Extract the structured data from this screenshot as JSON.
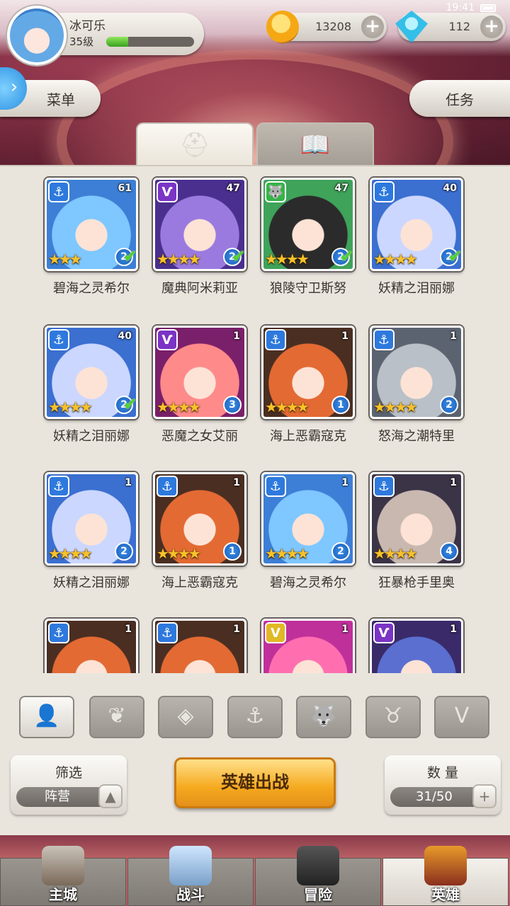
{
  "status": {
    "time": "19:41"
  },
  "player": {
    "name": "冰可乐",
    "level": "35级",
    "xp_fraction": 0.25
  },
  "currency": {
    "gold": "13208",
    "gems": "112"
  },
  "menu_label": "菜单",
  "task_label": "任务",
  "tabs": [
    "heroes-helmet-icon",
    "book-icon"
  ],
  "heroes": [
    {
      "name": "碧海之灵希尔",
      "level": "61",
      "stars": 3,
      "badge": "2",
      "check": true,
      "faction": "anchor"
    },
    {
      "name": "魔典阿米莉亚",
      "level": "47",
      "stars": 4,
      "badge": "2",
      "check": true,
      "faction": "horns"
    },
    {
      "name": "狼陵守卫斯努",
      "level": "47",
      "stars": 4,
      "badge": "2",
      "check": true,
      "faction": "wolf"
    },
    {
      "name": "妖精之泪丽娜",
      "level": "40",
      "stars": 4,
      "badge": "2",
      "check": true,
      "faction": "anchor"
    },
    {
      "name": "妖精之泪丽娜",
      "level": "40",
      "stars": 4,
      "badge": "2",
      "check": true,
      "faction": "anchor"
    },
    {
      "name": "恶魔之女艾丽",
      "level": "1",
      "stars": 4,
      "badge": "3",
      "check": false,
      "faction": "horns"
    },
    {
      "name": "海上恶霸寇克",
      "level": "1",
      "stars": 4,
      "badge": "1",
      "check": false,
      "faction": "anchor"
    },
    {
      "name": "怒海之潮特里",
      "level": "1",
      "stars": 4,
      "badge": "2",
      "check": false,
      "faction": "anchor"
    },
    {
      "name": "妖精之泪丽娜",
      "level": "1",
      "stars": 4,
      "badge": "2",
      "check": false,
      "faction": "anchor"
    },
    {
      "name": "海上恶霸寇克",
      "level": "1",
      "stars": 4,
      "badge": "1",
      "check": false,
      "faction": "anchor"
    },
    {
      "name": "碧海之灵希尔",
      "level": "1",
      "stars": 4,
      "badge": "2",
      "check": false,
      "faction": "anchor"
    },
    {
      "name": "狂暴枪手里奥",
      "level": "1",
      "stars": 4,
      "badge": "4",
      "check": false,
      "faction": "anchor"
    },
    {
      "name": "",
      "level": "1",
      "stars": 0,
      "badge": "",
      "check": false,
      "faction": "anchor"
    },
    {
      "name": "",
      "level": "1",
      "stars": 0,
      "badge": "",
      "check": false,
      "faction": "anchor"
    },
    {
      "name": "",
      "level": "1",
      "stars": 0,
      "badge": "",
      "check": false,
      "faction": "gold"
    },
    {
      "name": "",
      "level": "1",
      "stars": 0,
      "badge": "",
      "check": false,
      "faction": "horns"
    }
  ],
  "filters": [
    "person-icon",
    "leaf-icon",
    "diamond-icon",
    "anchor-icon",
    "wolf-icon",
    "horns-icon",
    "v-icon"
  ],
  "filter_box": {
    "title": "筛选",
    "value": "阵营"
  },
  "deploy_label": "英雄出战",
  "count_box": {
    "title": "数 量",
    "value": "31/50"
  },
  "nav": [
    {
      "label": "主城",
      "icon": "castle-icon"
    },
    {
      "label": "战斗",
      "icon": "swords-icon"
    },
    {
      "label": "冒险",
      "icon": "treasure-icon"
    },
    {
      "label": "英雄",
      "icon": "helmet-icon",
      "active": true
    }
  ],
  "colors": {
    "water": "#2e79dd",
    "purple": "#7b34c5",
    "green": "#34b546",
    "gold": "#e1b825",
    "deploy": "#f5a91e"
  }
}
